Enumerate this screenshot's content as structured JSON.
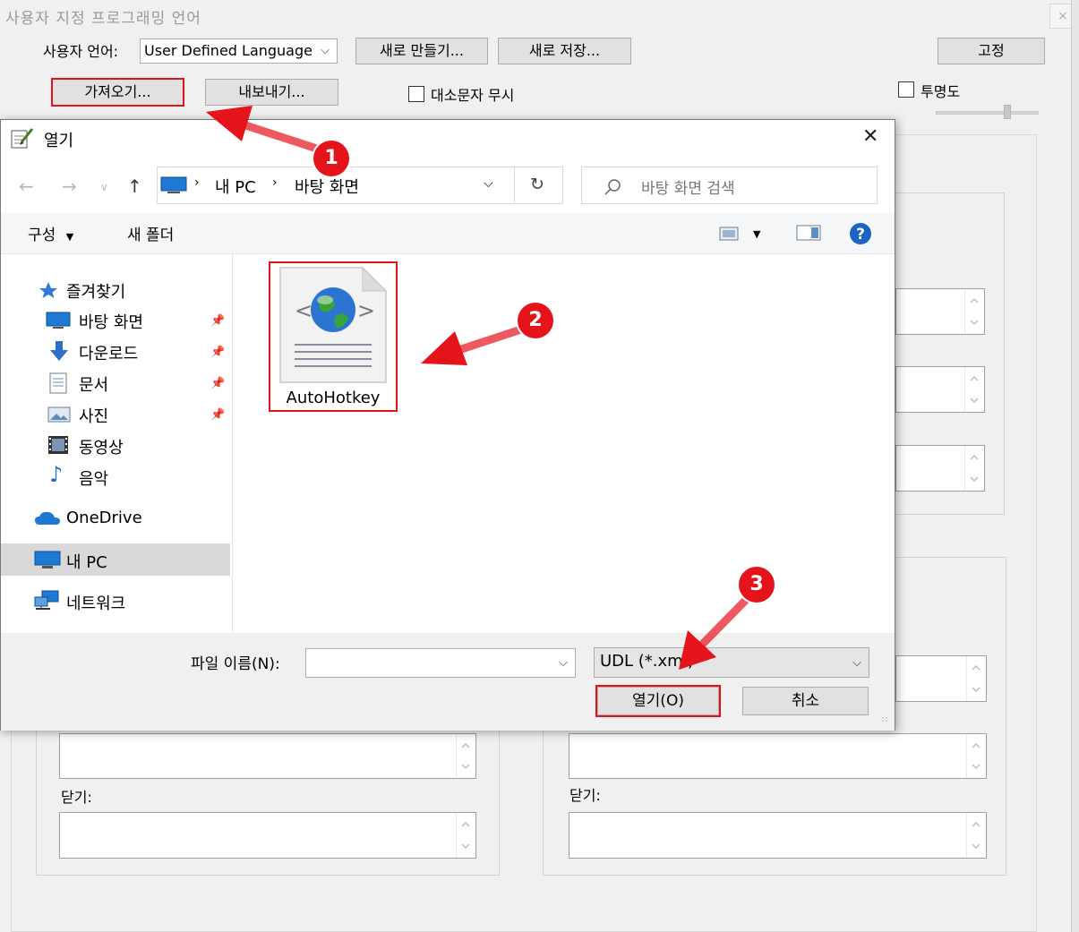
{
  "window": {
    "title": "사용자 지정 프로그래밍 언어",
    "close_glyph": "×"
  },
  "toolbar": {
    "user_language_label": "사용자 언어:",
    "user_language_value": "User Defined Language",
    "new_button": "새로 만들기...",
    "save_as_button": "새로 저장...",
    "pin_button": "고정",
    "import_button": "가져오기...",
    "export_button": "내보내기...",
    "ignore_case_label": "대소문자 무시",
    "transparency_label": "투명도"
  },
  "lower_panels": {
    "close_label_left": "닫기:",
    "close_label_right": "닫기:"
  },
  "dialog": {
    "title": "열기",
    "close_glyph": "✕",
    "breadcrumb": [
      "내 PC",
      "바탕 화면"
    ],
    "search_placeholder": "바탕 화면 검색",
    "organize_label": "구성",
    "new_folder_label": "새 폴더",
    "tree": {
      "favorites": "즐겨찾기",
      "items": [
        {
          "label": "바탕 화면",
          "icon": "desktop-icon"
        },
        {
          "label": "다운로드",
          "icon": "download-icon"
        },
        {
          "label": "문서",
          "icon": "document-icon"
        },
        {
          "label": "사진",
          "icon": "picture-icon"
        },
        {
          "label": "동영상",
          "icon": "video-icon"
        },
        {
          "label": "음악",
          "icon": "music-icon"
        }
      ],
      "onedrive": "OneDrive",
      "this_pc": "내 PC",
      "network": "네트워크"
    },
    "file": {
      "name": "AutoHotkey",
      "icon": "xml-globe-file-icon"
    },
    "filename_label": "파일 이름(N):",
    "filename_value": "",
    "filetype_value": "UDL (*.xml)",
    "open_button": "열기(O)",
    "cancel_button": "취소"
  },
  "annotations": {
    "steps": [
      "1",
      "2",
      "3"
    ],
    "highlight_color": "#e0121b"
  }
}
